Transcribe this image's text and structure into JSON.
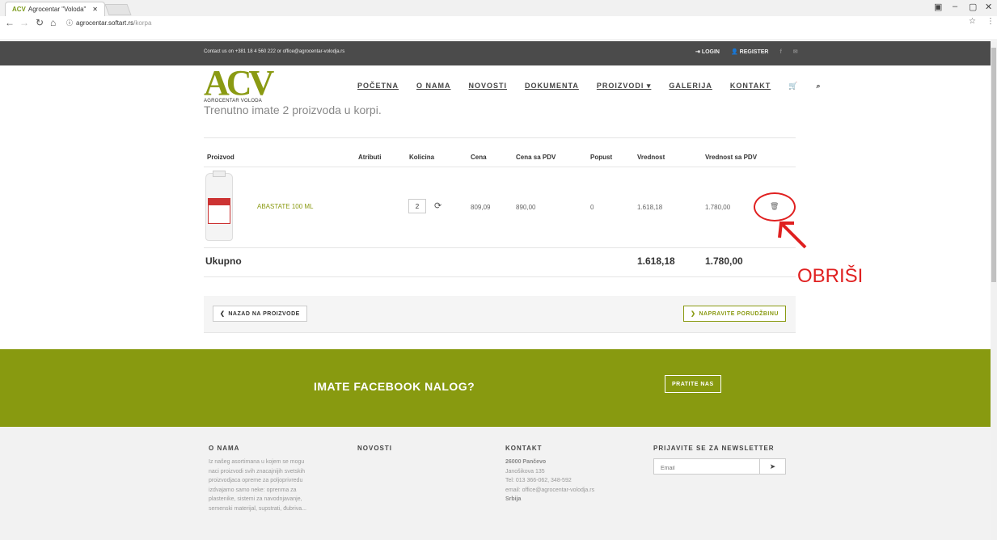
{
  "browser": {
    "tab_title": "Agrocentar \"Voloda\"",
    "url_domain": "agrocentar.softart.rs",
    "url_path": "/korpa"
  },
  "topbar": {
    "contact": "Contact us on +381 18 4 560 222 or office@agrocentar-volodja.rs",
    "login": "LOGIN",
    "register": "REGISTER"
  },
  "logo": {
    "mark": "ACV",
    "name": "AGROCENTAR VOLODA"
  },
  "menu": [
    "POČETNA",
    "O NAMA",
    "NOVOSTI",
    "DOKUMENTA",
    "PROIZVODI ▾",
    "GALERIJA",
    "KONTAKT"
  ],
  "cart": {
    "note": "Trenutno imate 2 proizvoda u korpi.",
    "headers": {
      "product": "Proizvod",
      "attr": "Atributi",
      "qty": "Kolicina",
      "price": "Cena",
      "price_vat": "Cena sa PDV",
      "discount": "Popust",
      "value": "Vrednost",
      "value_vat": "Vrednost sa PDV"
    },
    "item": {
      "name": "ABASTATE 100 ML",
      "qty": "2",
      "price": "809,09",
      "price_vat": "890,00",
      "discount": "0",
      "value": "1.618,18",
      "value_vat": "1.780,00"
    },
    "total_label": "Ukupno",
    "total": "1.618,18",
    "total_vat": "1.780,00",
    "back": "NAZAD NA PROIZVODE",
    "order": "NAPRAVITE PORUDŽBINU",
    "annotation": "OBRIŠI"
  },
  "facebook": {
    "question": "IMATE FACEBOOK NALOG?",
    "button": "PRATITE NAS"
  },
  "footer": {
    "about_title": "O NAMA",
    "about_text": [
      "Iz našeg asortimana u kojem se mogu",
      "naci proizvodi svih znacajnijih svetskih",
      "proizvodjaca opreme za poljoprivredu",
      "izdvajamo samo neke: oprenma za",
      "plastenike, sistemi za navodnjavanje,",
      "semenski materijal, supstrati, đubriva..."
    ],
    "news_title": "NOVOSTI",
    "contact_title": "KONTAKT",
    "contact": {
      "city": "26000 Pančevo",
      "street": "Janošikova 135",
      "tel": "Tel: 013 366-062, 348-592",
      "email": "email: office@agrocentar-volodja.rs",
      "country": "Srbija"
    },
    "newsletter_title": "PRIJAVITE SE ZA NEWSLETTER",
    "newsletter_placeholder": "Email"
  }
}
